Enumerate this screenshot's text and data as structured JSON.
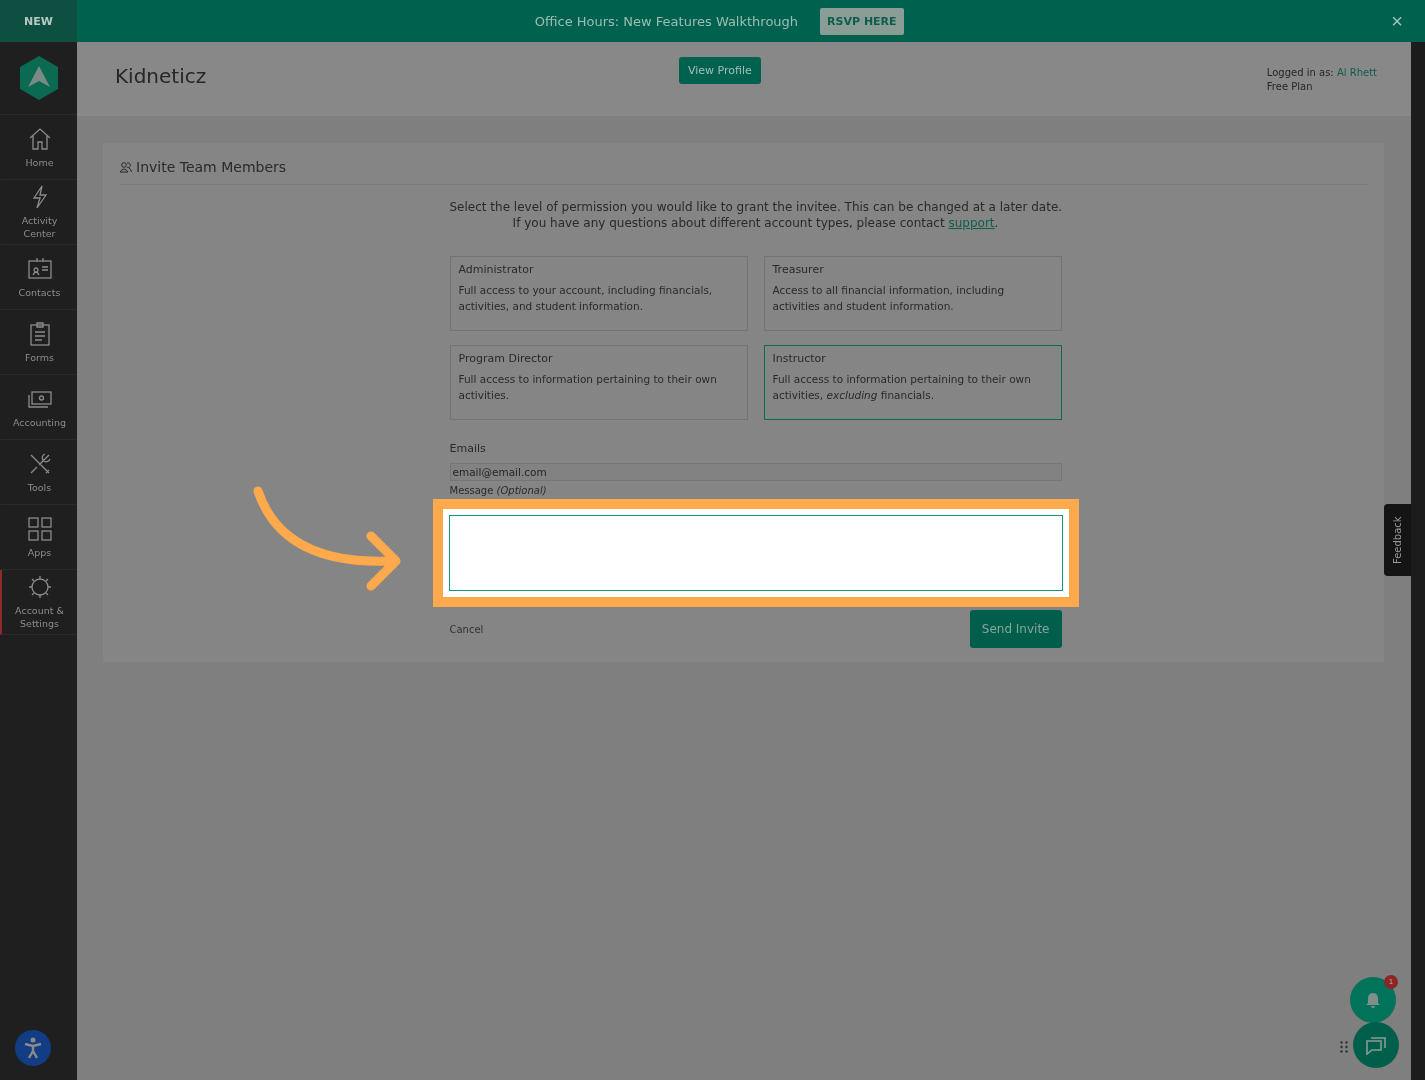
{
  "banner": {
    "badge": "NEW",
    "message": "Office Hours: New Features Walkthrough",
    "button": "RSVP HERE",
    "close": "×"
  },
  "header": {
    "title": "Kidneticz",
    "button": "View Profile",
    "logged_in_label": "Logged in as:",
    "user": "Al Rhett",
    "plan": "Free Plan"
  },
  "sidebar": {
    "items": [
      {
        "kind": "home",
        "label": "Home",
        "selected": false
      },
      {
        "kind": "bolt",
        "label": "Activity Center",
        "selected": false
      },
      {
        "kind": "contacts",
        "label": "Contacts",
        "selected": false
      },
      {
        "kind": "forms",
        "label": "Forms",
        "selected": false
      },
      {
        "kind": "money",
        "label": "Accounting",
        "selected": false
      },
      {
        "kind": "tools",
        "label": "Tools",
        "selected": false
      },
      {
        "kind": "apps",
        "label": "Apps",
        "selected": false
      },
      {
        "kind": "gear",
        "label": "Account & Settings",
        "selected": true
      }
    ]
  },
  "card": {
    "title": "Invite Team Members",
    "intro_1": "Select the level of permission you would like to grant the invitee. This can be changed at a later date.",
    "intro_2": {
      "text": "If you have any questions about different account types, please contact",
      "link": "support",
      "after": "."
    },
    "roles": [
      {
        "name": "Administrator",
        "description": "Full access to your account, including financials, activities, and student information.",
        "selected": false
      },
      {
        "name": "Treasurer",
        "description": "Access to all financial information, including activities and student information.",
        "selected": false
      },
      {
        "name": "Program Director",
        "description": "Full access to information pertaining to their own activities.",
        "selected": false
      },
      {
        "name": "Instructor",
        "description": "Full access to information pertaining to their own activities, *excluding* financials.",
        "selected": true
      }
    ],
    "emails": {
      "label": "Emails",
      "value": "email@email.com"
    },
    "message": {
      "label": "Message *(Optional)*"
    },
    "cancel": "Cancel",
    "send": "Send Invite"
  },
  "feedback": "Feedback",
  "notifications": {
    "count": "1"
  }
}
